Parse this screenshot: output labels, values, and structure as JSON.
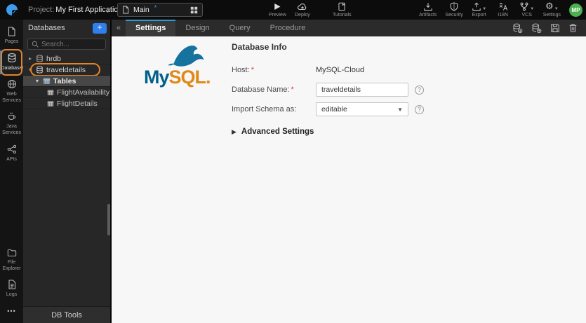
{
  "topbar": {
    "project_label": "Project:",
    "project_name": "My First Application",
    "page_tab": {
      "label": "Main",
      "modified": "*"
    },
    "actions": [
      {
        "label": "Preview"
      },
      {
        "label": "Deploy"
      },
      {
        "label": "Tutorials"
      },
      {
        "label": "Artifacts"
      },
      {
        "label": "Security"
      },
      {
        "label": "Export"
      },
      {
        "label": "I18N"
      },
      {
        "label": "VCS"
      },
      {
        "label": "Settings"
      }
    ],
    "avatar_initials": "MP"
  },
  "sidebar": {
    "items": [
      {
        "label": "Pages"
      },
      {
        "label": "Databases",
        "active": true
      },
      {
        "label": "Web Services"
      },
      {
        "label": "Java Services"
      },
      {
        "label": "APIs"
      }
    ],
    "bottom_items": [
      {
        "label": "File Explorer"
      },
      {
        "label": "Logs"
      },
      {
        "label": "•••"
      }
    ]
  },
  "panel": {
    "title": "Databases",
    "add_button": "+",
    "search_placeholder": "Search...",
    "tree": [
      {
        "label": "hrdb",
        "type": "database",
        "expanded": false
      },
      {
        "label": "traveldetails",
        "type": "database",
        "expanded": true,
        "highlighted": true
      },
      {
        "label": "Tables",
        "type": "table-group",
        "expanded": true,
        "selected": true
      },
      {
        "label": "FlightAvailability",
        "type": "table"
      },
      {
        "label": "FlightDetails",
        "type": "table"
      }
    ],
    "footer": "DB Tools"
  },
  "tabbar": {
    "collapse_glyph": "«",
    "tabs": [
      {
        "label": "Settings",
        "active": true
      },
      {
        "label": "Design"
      },
      {
        "label": "Query"
      },
      {
        "label": "Procedure"
      }
    ]
  },
  "content": {
    "logo": {
      "my": "My",
      "sql": "SQL",
      "dot": "."
    },
    "heading": "Database Info",
    "required_marker": "*",
    "help_glyph": "?",
    "fields": {
      "host_label": "Host:",
      "host_value": "MySQL-Cloud",
      "db_name_label": "Database Name:",
      "db_name_value": "traveldetails",
      "import_label": "Import Schema as:",
      "import_value": "editable"
    },
    "advanced_label": "Advanced Settings"
  },
  "colors": {
    "accent_blue": "#2e9bd6",
    "annotation_orange": "#e2832a",
    "avatar_green": "#4caf50",
    "mysql_blue": "#00618a",
    "mysql_orange": "#e0891a",
    "required_red": "#e53935"
  }
}
